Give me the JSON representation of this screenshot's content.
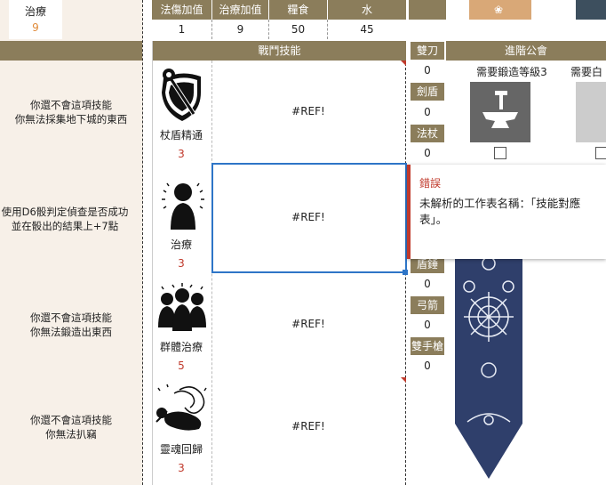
{
  "left": {
    "heal_label": "治療",
    "heal_value": "9",
    "skill_texts": [
      [
        "你還不會這項技能",
        "你無法採集地下城的東西"
      ],
      [
        "使用D6骰判定偵查是否成功",
        "並在骰出的結果上+7點"
      ],
      [
        "你還不會這項技能",
        "你無法鍛造出東西"
      ],
      [
        "你還不會這項技能",
        "你無法扒竊"
      ]
    ]
  },
  "stats": {
    "headers": [
      "法傷加值",
      "治療加值",
      "糧食",
      "水"
    ],
    "values": [
      "1",
      "9",
      "50",
      "45"
    ]
  },
  "combat": {
    "header": "戰鬥技能",
    "skills": [
      {
        "name": "杖盾精通",
        "level": "3",
        "ref": "#REF!",
        "icon": "staff-shield-icon"
      },
      {
        "name": "治療",
        "level": "3",
        "ref": "#REF!",
        "icon": "heal-person-icon"
      },
      {
        "name": "群體治療",
        "level": "5",
        "ref": "#REF!",
        "icon": "group-heal-icon"
      },
      {
        "name": "靈魂回歸",
        "level": "3",
        "ref": "#REF!",
        "icon": "soul-return-icon"
      }
    ]
  },
  "weapons": {
    "items": [
      {
        "label": "雙刀",
        "value": "0"
      },
      {
        "label": "劍盾",
        "value": "0"
      },
      {
        "label": "法杖",
        "value": "0"
      },
      {
        "label": "盾錘",
        "value": "0"
      },
      {
        "label": "弓箭",
        "value": "0"
      },
      {
        "label": "雙手槍",
        "value": "0"
      }
    ]
  },
  "guild": {
    "header": "進階公會",
    "req1": "需要鍛造等級3",
    "req2": "需要白",
    "icon": "anvil-icon"
  },
  "tooltip": {
    "title": "錯誤",
    "body_line1": "未解析的工作表名稱：「技能對應",
    "body_line2": "表」。"
  },
  "colors": {
    "header_bg": "#8b7d5b",
    "level_red": "#c0392b",
    "heal_orange": "#e08b3a",
    "banner_navy": "#2f3f6b",
    "selection_blue": "#2e75c7"
  }
}
